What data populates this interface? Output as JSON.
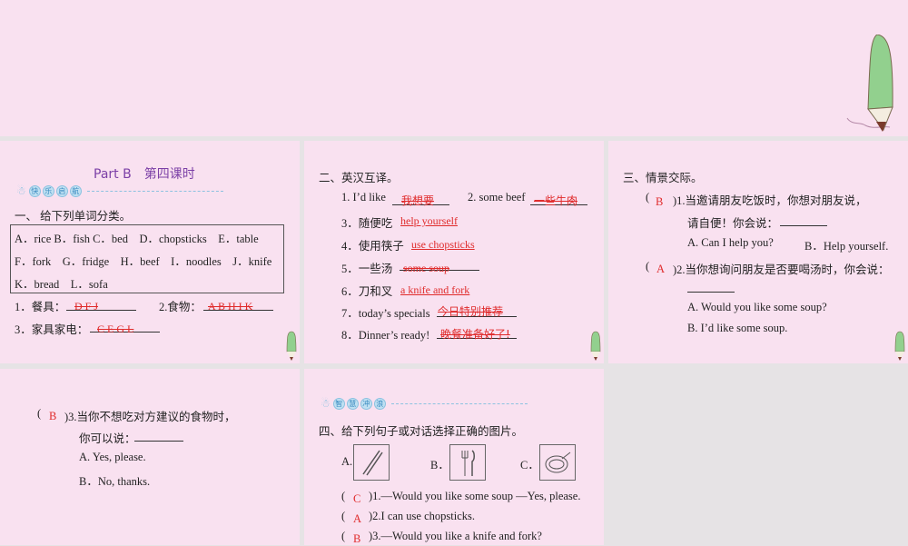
{
  "slide1": {
    "title": "Part B",
    "title_cn": "第四课时",
    "banner": [
      "快",
      "乐",
      "启",
      "航"
    ],
    "heading": "一、 给下列单词分类。",
    "words_rows": [
      "A．rice B．fish C．bed　D．chopsticks　E．table",
      "F．fork　G．fridge　H．beef　I．noodles　J．knife",
      "K．bread　L．sofa"
    ],
    "q1_label": "1．餐具：",
    "q1_answer": "D F J",
    "q2_label": "2.食物：",
    "q2_answer": "A B H I K",
    "q3_label": "3．家具家电：",
    "q3_answer": "C E G L"
  },
  "slide2": {
    "heading": "二、英汉互译。",
    "items": [
      {
        "label": "1. I’d like",
        "answer": "我想要"
      },
      {
        "label": "2. some beef",
        "answer": "一些牛肉"
      },
      {
        "label": "3．随便吃",
        "answer": "help yourself"
      },
      {
        "label": "4．使用筷子",
        "answer": "use chopsticks"
      },
      {
        "label": "5．一些汤",
        "answer": "some soup"
      },
      {
        "label": "6．刀和叉",
        "answer": "a knife and fork"
      },
      {
        "label": "7．today’s specials",
        "answer": "今日特别推荐"
      },
      {
        "label": "8．Dinner’s ready!",
        "answer": "晚餐准备好了!"
      }
    ]
  },
  "slide3": {
    "heading": "三、情景交际。",
    "q1": {
      "answer": "B",
      "text": ")1.当邀请朋友吃饭时，你想对朋友说，",
      "line2": "请自便！你会说：",
      "optA": "A. Can I help you?",
      "optB": "B．Help yourself."
    },
    "q2": {
      "answer": "A",
      "text": ")2.当你想询问朋友是否要喝汤时，你会说：",
      "optA": "A. Would you like some soup?",
      "optB": "B. I’d like some soup."
    }
  },
  "slide4": {
    "q3": {
      "answer": "B",
      "text": ")3.当你不想吃对方建议的食物时，",
      "line2": "你可以说：",
      "optA": "A. Yes, please.",
      "optB": "B．No, thanks."
    }
  },
  "slide5": {
    "banner": [
      "智",
      "慧",
      "冲",
      "浪"
    ],
    "heading": "四、给下列句子或对话选择正确的图片。",
    "pic_labels": [
      "A.",
      "B．",
      "C．"
    ],
    "items": [
      {
        "answer": "C",
        "text": ")1.—Would you like some soup —Yes, please."
      },
      {
        "answer": "A",
        "text": ")2.I can use chopsticks."
      },
      {
        "answer": "B",
        "text": ")3.—Would you like a knife and fork?"
      }
    ]
  },
  "colors": {
    "bg": "#f9e1f0",
    "answer": "#e02b2b",
    "title": "#7b3fa6"
  }
}
